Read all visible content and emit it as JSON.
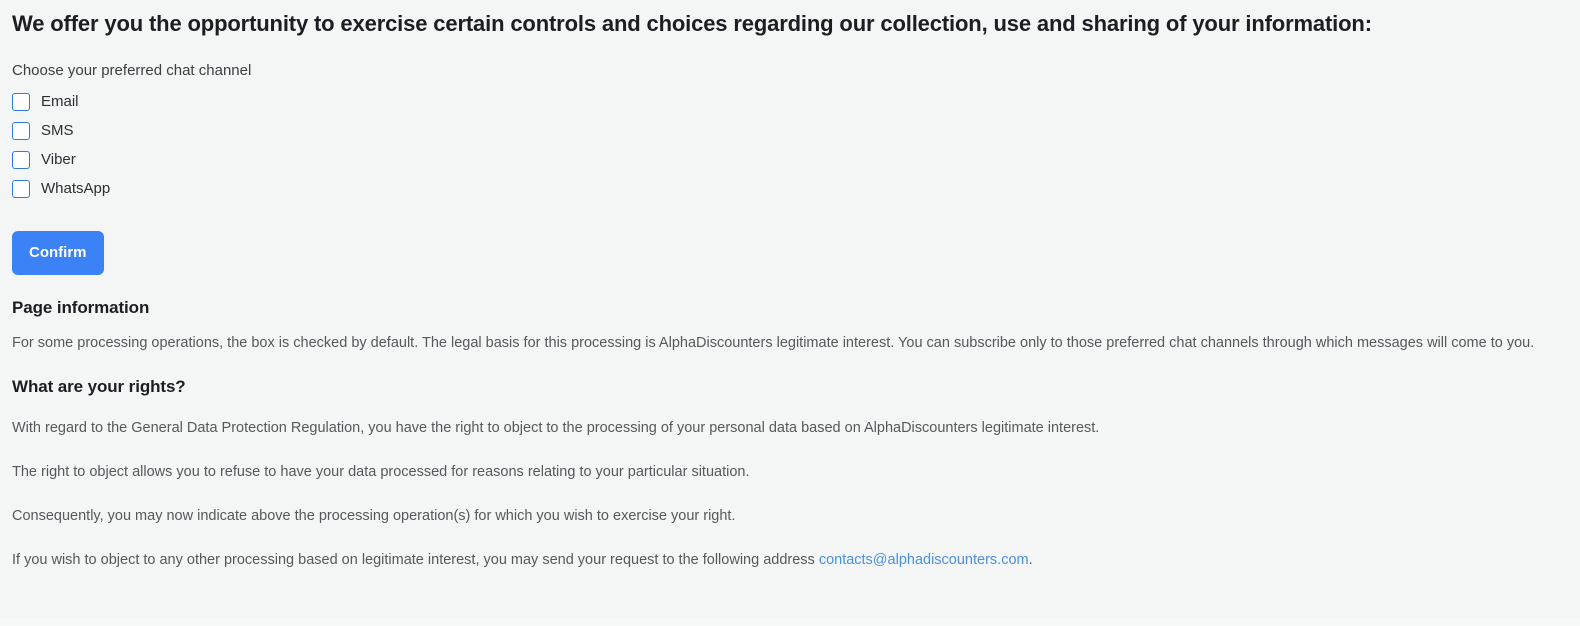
{
  "page": {
    "heading": "We offer you the opportunity to exercise certain controls and choices regarding our collection, use and sharing of your information:",
    "background_color": "#f4f5f5"
  },
  "preferences": {
    "label": "Choose your preferred chat channel",
    "channels": [
      {
        "label": "Email",
        "checked": false
      },
      {
        "label": "SMS",
        "checked": false
      },
      {
        "label": "Viber",
        "checked": false
      },
      {
        "label": "WhatsApp",
        "checked": false
      }
    ],
    "confirm_label": "Confirm",
    "confirm_color": "#3b82f6",
    "checkbox_border_color": "#2f7ddb"
  },
  "page_information": {
    "heading": "Page information",
    "text": "For some processing operations, the box is checked by default. The legal basis for this processing is AlphaDiscounters legitimate interest. You can subscribe only to those preferred chat channels through which messages will come to you."
  },
  "rights": {
    "heading": "What are your rights?",
    "paragraphs": [
      "With regard to the General Data Protection Regulation, you have the right to object to the processing of your personal data based on AlphaDiscounters legitimate interest.",
      "The right to object allows you to refuse to have your data processed for reasons relating to your particular situation.",
      "Consequently, you may now indicate above the processing operation(s) for which you wish to exercise your right."
    ],
    "contact_paragraph": {
      "prefix": "If you wish to object to any other processing based on legitimate interest, you may send your request to the following address ",
      "email": "contacts@alphadiscounters.com",
      "suffix": ".",
      "link_color": "#4a90e2"
    }
  }
}
